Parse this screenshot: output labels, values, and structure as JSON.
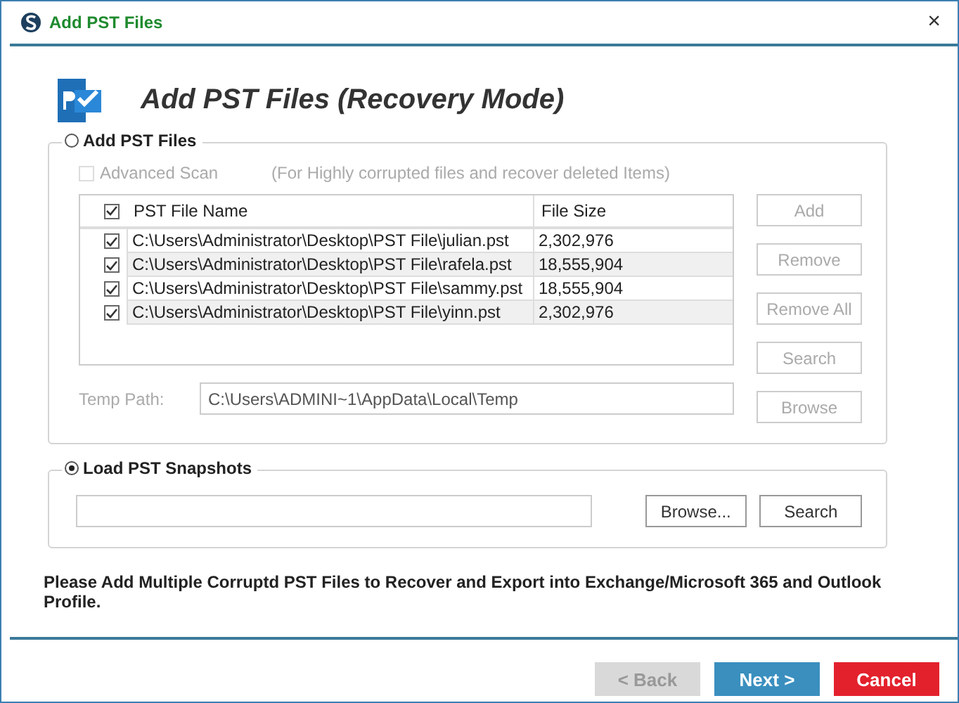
{
  "window": {
    "title": "Add PST Files",
    "close": "×"
  },
  "heading": "Add PST Files (Recovery Mode)",
  "add_section": {
    "label": "Add PST Files",
    "selected": false,
    "advanced_scan": {
      "label": "Advanced Scan",
      "checked": false,
      "disabled": true
    },
    "advanced_hint": "(For Highly corrupted files and recover deleted Items)",
    "table": {
      "all_checked": true,
      "columns": [
        "PST File Name",
        "File Size"
      ],
      "rows": [
        {
          "checked": true,
          "name": "C:\\Users\\Administrator\\Desktop\\PST File\\julian.pst",
          "size": "2,302,976"
        },
        {
          "checked": true,
          "name": "C:\\Users\\Administrator\\Desktop\\PST File\\rafela.pst",
          "size": "18,555,904"
        },
        {
          "checked": true,
          "name": "C:\\Users\\Administrator\\Desktop\\PST File\\sammy.pst",
          "size": "18,555,904"
        },
        {
          "checked": true,
          "name": "C:\\Users\\Administrator\\Desktop\\PST File\\yinn.pst",
          "size": "2,302,976"
        }
      ]
    },
    "buttons": [
      {
        "label": "Add",
        "disabled": true
      },
      {
        "label": "Remove",
        "disabled": true
      },
      {
        "label": "Remove All",
        "disabled": true
      },
      {
        "label": "Search",
        "disabled": true
      }
    ],
    "temp_path": {
      "label": "Temp Path:",
      "value": "C:\\Users\\ADMINI~1\\AppData\\Local\\Temp",
      "disabled": true
    },
    "browse": {
      "label": "Browse",
      "disabled": true
    }
  },
  "snapshot_section": {
    "label": "Load PST Snapshots",
    "selected": true,
    "buttons": [
      {
        "label": "Browse...",
        "disabled": false
      },
      {
        "label": "Search",
        "disabled": false
      }
    ]
  },
  "note": "Please Add Multiple Corruptd PST Files to Recover and Export into Exchange/Microsoft 365 and Outlook Profile.",
  "footer": [
    {
      "label": "< Back",
      "kind": "back",
      "disabled": true
    },
    {
      "label": "Next >",
      "kind": "next",
      "disabled": false
    },
    {
      "label": "Cancel",
      "kind": "cancel",
      "disabled": false
    }
  ]
}
